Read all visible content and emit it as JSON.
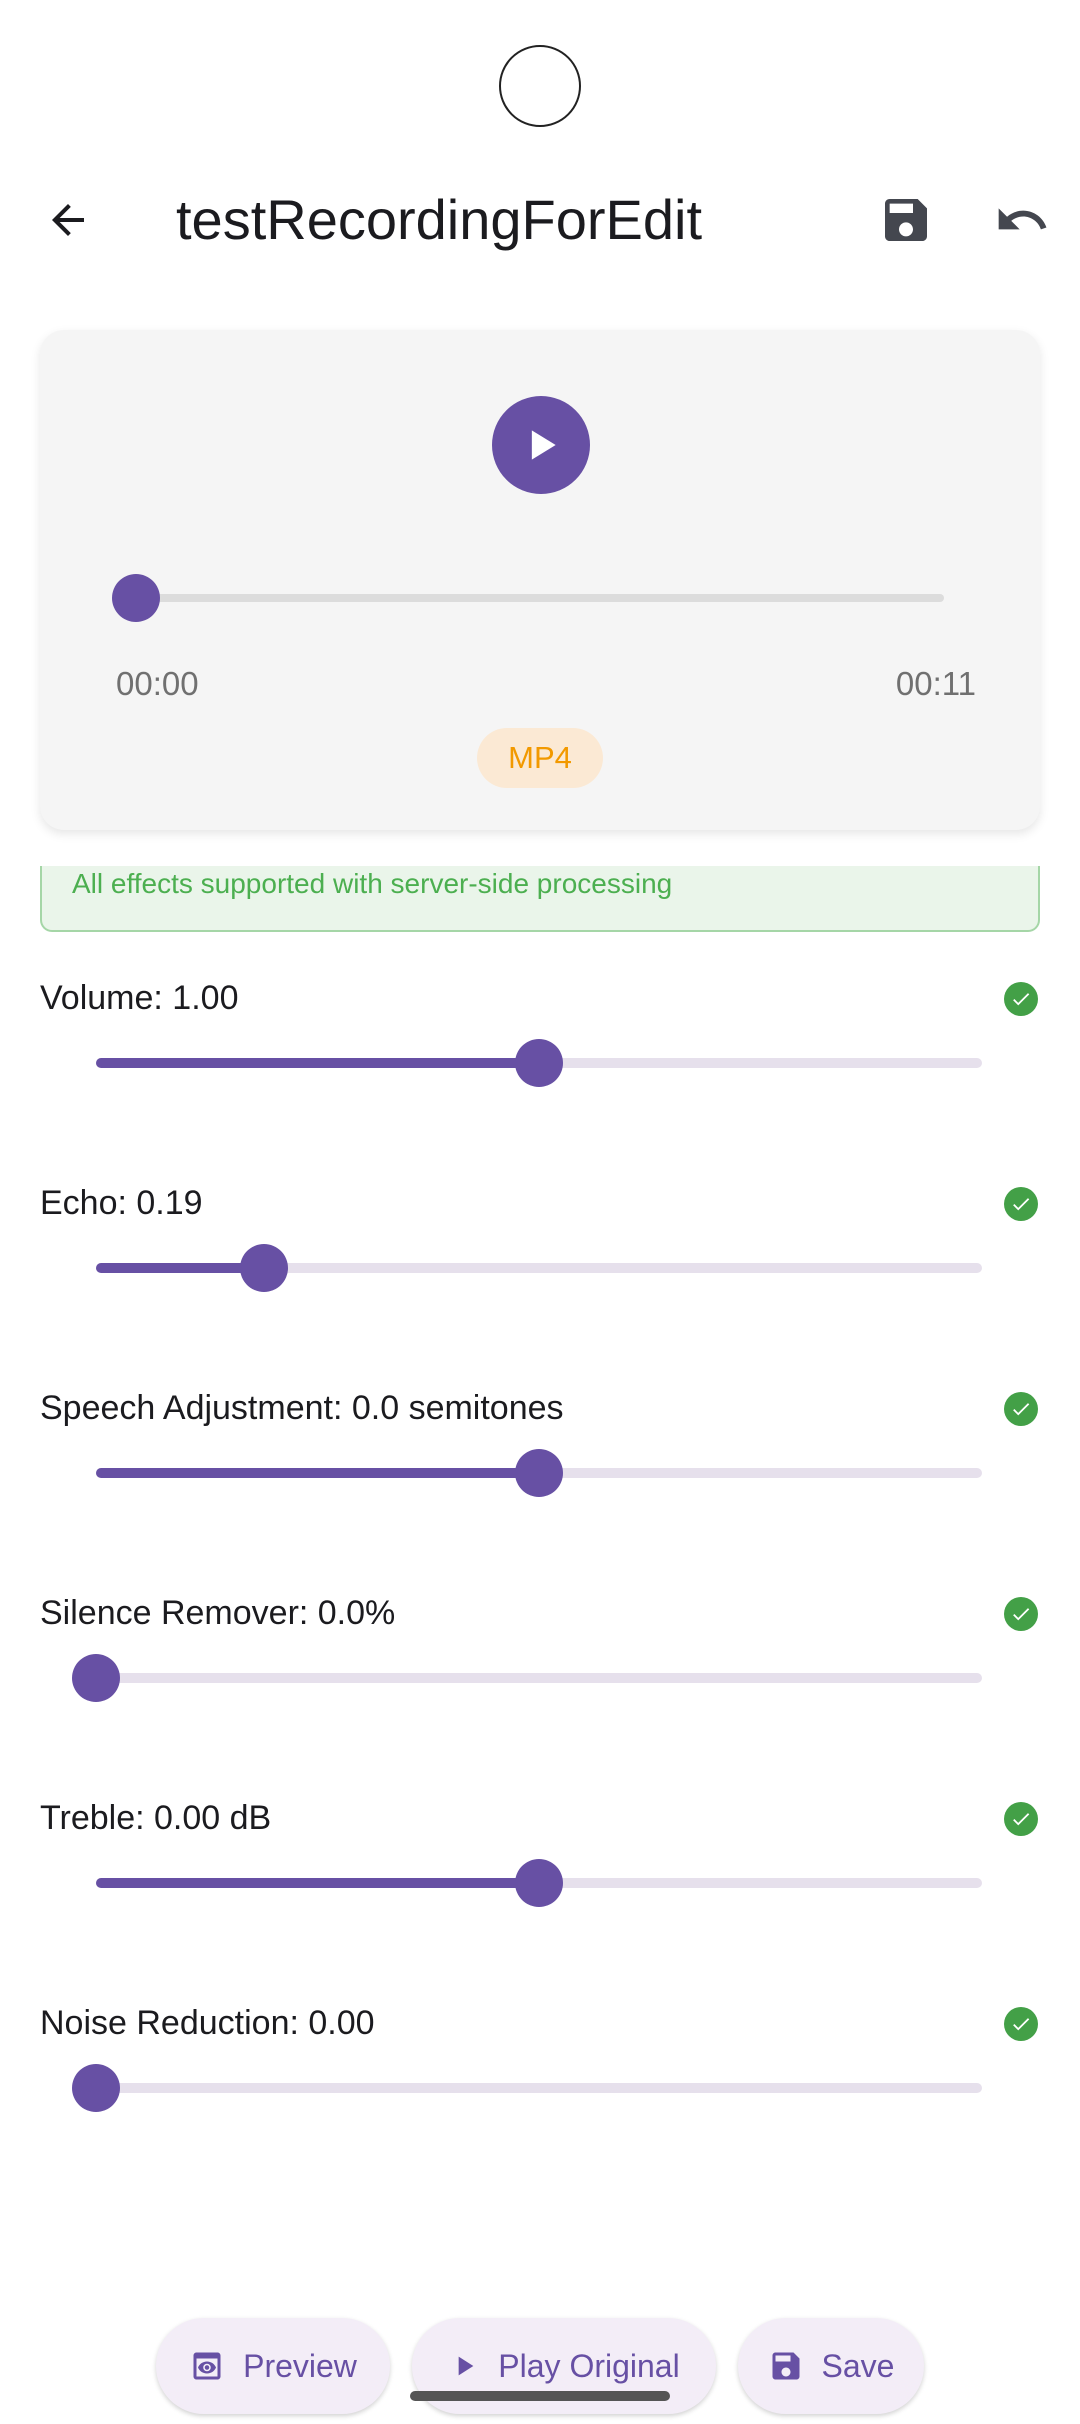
{
  "header": {
    "title": "testRecordingForEdit",
    "back_icon": "arrow-back-icon",
    "save_icon": "save-icon",
    "undo_icon": "undo-icon"
  },
  "player": {
    "play_icon": "play-icon",
    "current_time": "00:00",
    "duration": "00:11",
    "format_badge": "MP4",
    "progress_fraction": 0.0
  },
  "notice": {
    "text": "All effects supported with server-side processing"
  },
  "effects": [
    {
      "label": "Volume: 1.00",
      "value_fraction": 0.5,
      "status_icon": "check-circle-icon"
    },
    {
      "label": "Echo: 0.19",
      "value_fraction": 0.19,
      "status_icon": "check-circle-icon"
    },
    {
      "label": "Speech Adjustment: 0.0 semitones",
      "value_fraction": 0.5,
      "status_icon": "check-circle-icon"
    },
    {
      "label": "Silence Remover: 0.0%",
      "value_fraction": 0.0,
      "status_icon": "check-circle-icon"
    },
    {
      "label": "Treble: 0.00 dB",
      "value_fraction": 0.5,
      "status_icon": "check-circle-icon"
    },
    {
      "label": "Noise Reduction: 0.00",
      "value_fraction": 0.0,
      "status_icon": "check-circle-icon"
    }
  ],
  "actions": {
    "preview_label": "Preview",
    "play_original_label": "Play Original",
    "save_label": "Save"
  },
  "colors": {
    "accent": "#6750a4",
    "success": "#43a047",
    "badge_text": "#f29900"
  }
}
